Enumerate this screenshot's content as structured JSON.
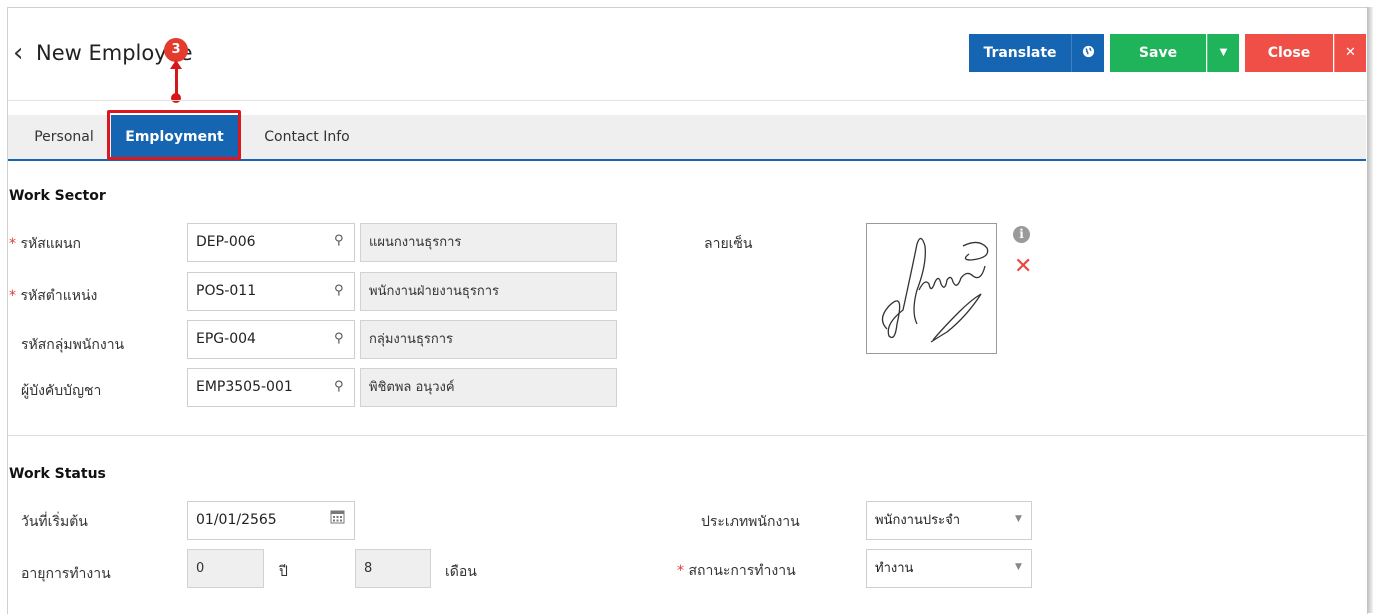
{
  "header": {
    "back_icon": "chevron-left-icon",
    "title": "New Employee",
    "step_number": "3",
    "buttons": {
      "translate_label": "Translate",
      "translate_icon": "globe-icon",
      "save_label": "Save",
      "save_caret": "caret-down-icon",
      "close_label": "Close",
      "close_icon": "close-icon"
    }
  },
  "tabs": [
    {
      "label": "Personal"
    },
    {
      "label": "Employment"
    },
    {
      "label": "Contact Info"
    }
  ],
  "work_sector": {
    "title": "Work Sector",
    "rows": [
      {
        "label": "รหัสแผนก",
        "required_mark": "*",
        "code": "DEP-006",
        "name": "แผนกงานธุรการ"
      },
      {
        "label": "รหัสตำแหน่ง",
        "required_mark": "*",
        "code": "POS-011",
        "name": "พนักงานฝ่ายงานธุรการ"
      },
      {
        "label": "รหัสกลุ่มพนักงาน",
        "code": "EPG-004",
        "name": "กลุ่มงานธุรการ"
      },
      {
        "label": "ผู้บังคับบัญชา",
        "code": "EMP3505-001",
        "name": "พิชิตพล อนุวงค์"
      }
    ],
    "signature_label": "ลายเซ็น"
  },
  "work_status": {
    "title": "Work Status",
    "start_date_label": "วันที่เริ่มต้น",
    "start_date_value": "01/01/2565",
    "tenure_label": "อายุการทำงาน",
    "tenure_years": "0",
    "years_unit": "ปี",
    "tenure_months": "8",
    "months_unit": "เดือน",
    "employee_type_label": "ประเภทพนักงาน",
    "employee_type_value": "พนักงานประจำ",
    "work_status_label": "สถานะการทำงาน",
    "work_status_required_mark": "*",
    "work_status_value": "ทำงาน"
  },
  "colors": {
    "primary": "#1565b2",
    "save": "#1fb35a",
    "close": "#ef4f47",
    "highlight": "#d9191f"
  }
}
